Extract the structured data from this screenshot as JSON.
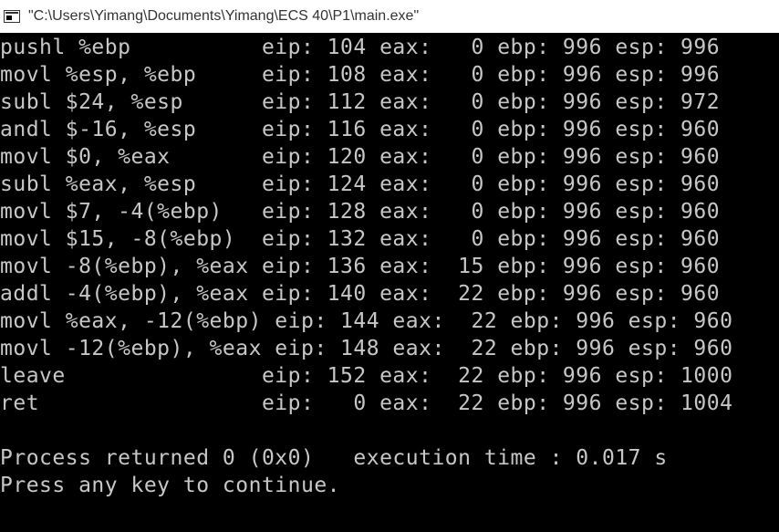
{
  "window": {
    "title": "\"C:\\Users\\Yimang\\Documents\\Yimang\\ECS 40\\P1\\main.exe\"",
    "icon": "console-app-icon"
  },
  "console": {
    "colors": {
      "background": "#000000",
      "text": "#c7c7c7"
    },
    "trace_lines": [
      "pushl %ebp          eip: 104 eax:   0 ebp: 996 esp: 996",
      "movl %esp, %ebp     eip: 108 eax:   0 ebp: 996 esp: 996",
      "subl $24, %esp      eip: 112 eax:   0 ebp: 996 esp: 972",
      "andl $-16, %esp     eip: 116 eax:   0 ebp: 996 esp: 960",
      "movl $0, %eax       eip: 120 eax:   0 ebp: 996 esp: 960",
      "subl %eax, %esp     eip: 124 eax:   0 ebp: 996 esp: 960",
      "movl $7, -4(%ebp)   eip: 128 eax:   0 ebp: 996 esp: 960",
      "movl $15, -8(%ebp)  eip: 132 eax:   0 ebp: 996 esp: 960",
      "movl -8(%ebp), %eax eip: 136 eax:  15 ebp: 996 esp: 960",
      "addl -4(%ebp), %eax eip: 140 eax:  22 ebp: 996 esp: 960",
      "movl %eax, -12(%ebp) eip: 144 eax:  22 ebp: 996 esp: 960",
      "movl -12(%ebp), %eax eip: 148 eax:  22 ebp: 996 esp: 960",
      "leave               eip: 152 eax:  22 ebp: 996 esp: 1000",
      "ret                 eip:   0 eax:  22 ebp: 996 esp: 1004"
    ],
    "process_line": "Process returned 0 (0x0)   execution time : 0.017 s",
    "prompt_line": "Press any key to continue."
  }
}
